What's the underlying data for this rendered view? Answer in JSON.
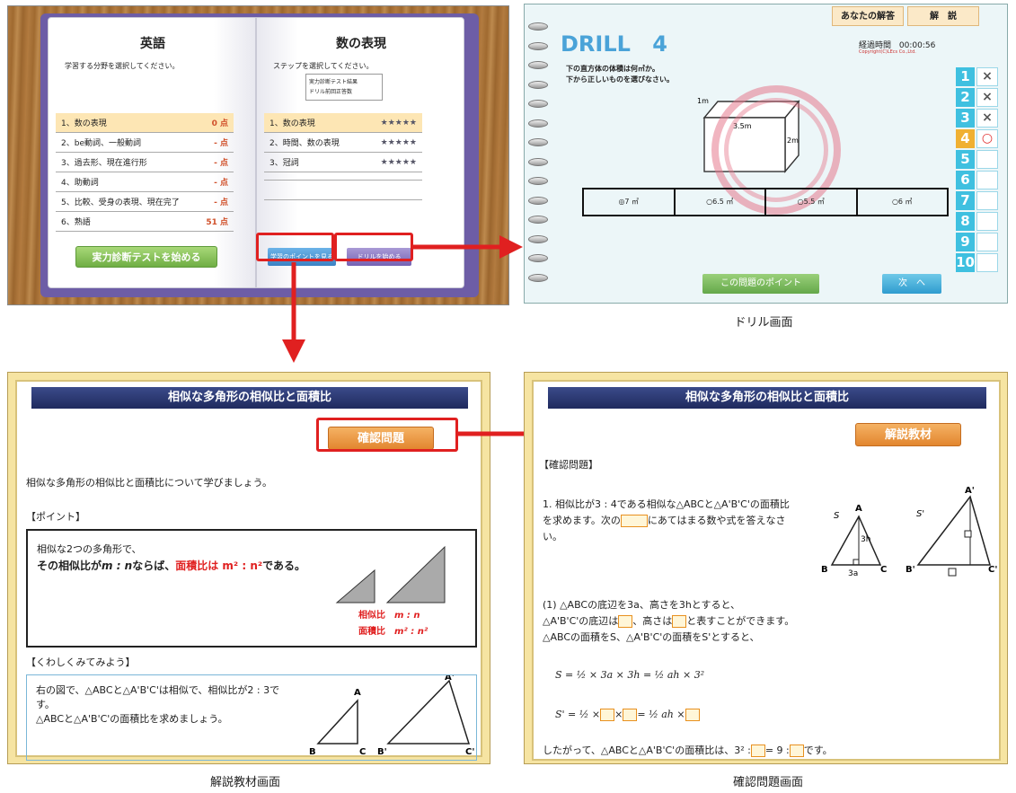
{
  "book": {
    "left_title": "英語",
    "left_instruction": "学習する分野を選択してください。",
    "units": [
      {
        "name": "1、数の表現",
        "score": "0 点"
      },
      {
        "name": "2、be動詞、一般動詞",
        "score": "- 点"
      },
      {
        "name": "3、過去形、現在進行形",
        "score": "- 点"
      },
      {
        "name": "4、助動詞",
        "score": "- 点"
      },
      {
        "name": "5、比較、受身の表現、現在完了",
        "score": "- 点"
      },
      {
        "name": "6、熟語",
        "score": "51 点"
      }
    ],
    "test_button": "実力診断テストを始める",
    "right_title": "数の表現",
    "right_instruction": "ステップを選択してください。",
    "legend": [
      "実力診断テスト結果",
      "ドリル前回正答数"
    ],
    "steps": [
      {
        "name": "1、数の表現",
        "stars": "★★★★★"
      },
      {
        "name": "2、時間、数の表現",
        "stars": "★★★★★"
      },
      {
        "name": "3、冠詞",
        "stars": "★★★★★"
      }
    ],
    "point_button": "学習のポイントを見る",
    "drill_button": "ドリルを始める"
  },
  "drill": {
    "tab_answer": "あなたの解答",
    "tab_explain": "解　説",
    "logo": "DRILL",
    "number": "4",
    "time_label": "経過時間",
    "time_value": "00:00:56",
    "copyright": "Copyright(C)LEcs Co.,Ltd.",
    "question_line1": "下の直方体の体積は何㎥か。",
    "question_line2": "下から正しいものを選びなさい。",
    "dim_width": "3.5m",
    "dim_height": "2m",
    "dim_depth": "1m",
    "choices": [
      "◎7 ㎥",
      "○6.5 ㎥",
      "○5.5 ㎥",
      "○6 ㎥"
    ],
    "numbers": [
      "1",
      "2",
      "3",
      "4",
      "5",
      "6",
      "7",
      "8",
      "9",
      "10"
    ],
    "marks": [
      "×",
      "×",
      "×",
      "○",
      "",
      "",
      "",
      "",
      "",
      ""
    ],
    "point_button": "この問題のポイント",
    "next_button": "次　へ",
    "caption": "ドリル画面"
  },
  "explain": {
    "banner": "相似な多角形の相似比と面積比",
    "confirm_button": "確認問題",
    "intro": "相似な多角形の相似比と面積比について学びましょう。",
    "point_heading": "【ポイント】",
    "point_line1": "相似な2つの多角形で、",
    "point_line2a": "その相似比が",
    "point_line2b": "m : n",
    "point_line2c": "ならば、",
    "point_line2d": "面積比は m² : n²",
    "point_line2e": "である。",
    "ratio_label1": "相似比",
    "ratio_val1": "m : n",
    "ratio_label2": "面積比",
    "ratio_val2": "m² : n²",
    "detail_heading": "【くわしくみてみよう】",
    "detail_line1": "右の図で、△ABCと△A'B'C'は相似で、相似比が2 : 3で",
    "detail_line2": "す。",
    "detail_line3": "△ABCと△A'B'C'の面積比を求めましょう。",
    "v_A": "A",
    "v_B": "B",
    "v_C": "C",
    "v_A2": "A'",
    "v_B2": "B'",
    "v_C2": "C'",
    "caption": "解説教材画面"
  },
  "check": {
    "banner": "相似な多角形の相似比と面積比",
    "explain_button": "解説教材",
    "heading": "【確認問題】",
    "q_line1": "1.  相似比が3 : 4である相似な△ABCと△A'B'C'の面積比",
    "q_line2a": "を求めます。次の",
    "q_line2b": "にあてはまる数や式を答えなさ",
    "q_line3": "い。",
    "fig_S": "S",
    "fig_A": "A",
    "fig_3h": "3h",
    "fig_B": "B",
    "fig_3a": "3a",
    "fig_C": "C",
    "fig_S2": "S'",
    "fig_A2": "A'",
    "fig_B2": "B'",
    "fig_C2": "C'",
    "s1_line1": "(1)  △ABCの底辺を3a、高さを3hとすると、",
    "s1_line2a": "△A'B'C'の底辺は",
    "s1_line2b": "、高さは",
    "s1_line2c": "と表すことができます。",
    "s1_line3": "△ABCの面積をS、△A'B'C'の面積をS'とすると、",
    "eq1": "S = ½ × 3a × 3h = ½ ah × 3²",
    "eq2a": "S' = ½ ×",
    "eq2b": "×",
    "eq2c": "= ½ ah ×",
    "concl_a": "したがって、△ABCと△A'B'C'の面積比は、3² :",
    "concl_b": "= 9 :",
    "concl_c": "です。",
    "caption": "確認問題画面"
  }
}
